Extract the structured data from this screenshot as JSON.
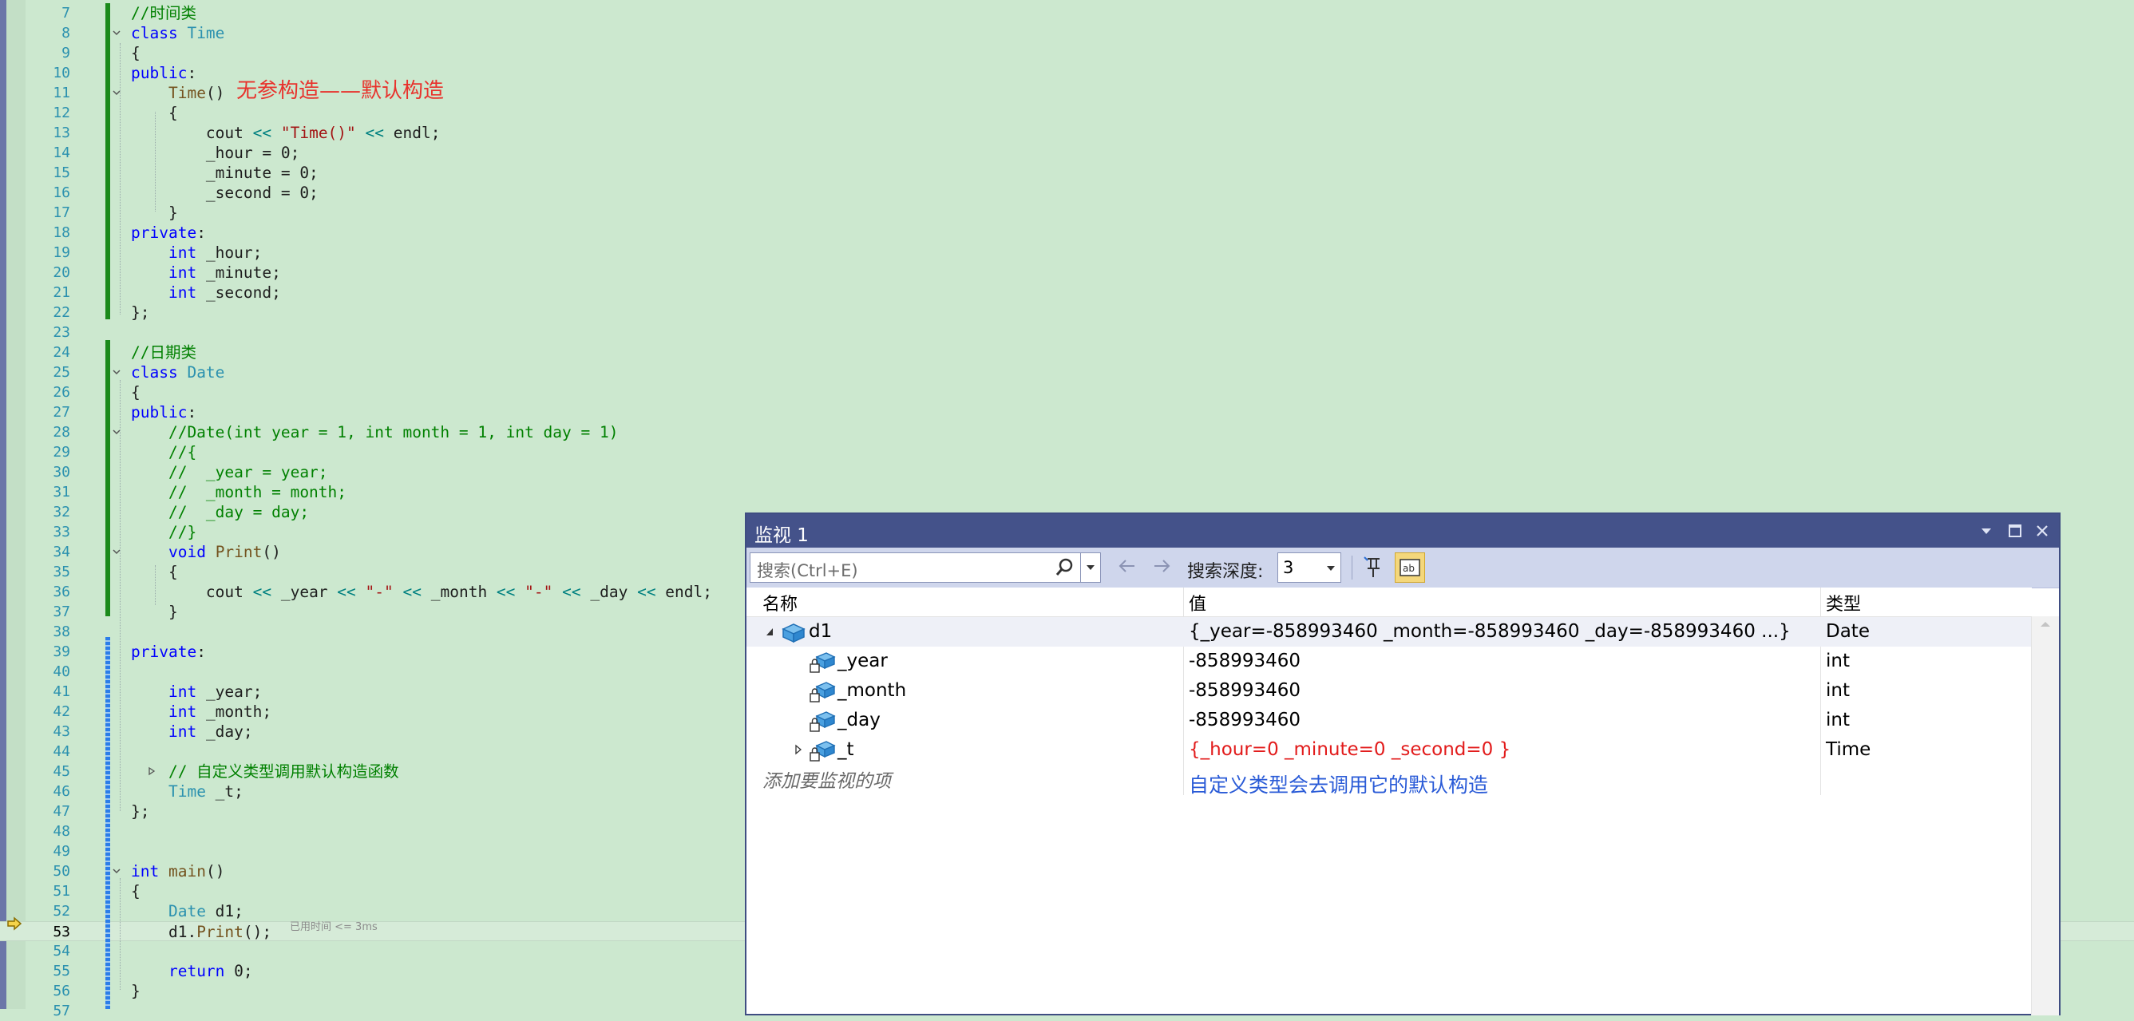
{
  "editor": {
    "lines": [
      {
        "n": "7",
        "segs": [
          {
            "c": "cm",
            "t": "//时间类"
          }
        ]
      },
      {
        "n": "8",
        "segs": [
          {
            "c": "kw",
            "t": "class "
          },
          {
            "c": "type",
            "t": "Time"
          }
        ]
      },
      {
        "n": "9",
        "segs": [
          {
            "c": "",
            "t": "{"
          }
        ]
      },
      {
        "n": "10",
        "segs": [
          {
            "c": "kw",
            "t": "public"
          },
          {
            "c": "",
            "t": ":"
          }
        ]
      },
      {
        "n": "11",
        "segs": [
          {
            "c": "",
            "t": "    "
          },
          {
            "c": "fn",
            "t": "Time"
          },
          {
            "c": "",
            "t": "()"
          }
        ]
      },
      {
        "n": "12",
        "segs": [
          {
            "c": "",
            "t": "    {"
          }
        ]
      },
      {
        "n": "13",
        "segs": [
          {
            "c": "",
            "t": "        cout "
          },
          {
            "c": "op",
            "t": "<<"
          },
          {
            "c": "",
            "t": " "
          },
          {
            "c": "str",
            "t": "\"Time()\""
          },
          {
            "c": "",
            "t": " "
          },
          {
            "c": "op",
            "t": "<<"
          },
          {
            "c": "",
            "t": " endl;"
          }
        ]
      },
      {
        "n": "14",
        "segs": [
          {
            "c": "",
            "t": "        _hour = 0;"
          }
        ]
      },
      {
        "n": "15",
        "segs": [
          {
            "c": "",
            "t": "        _minute = 0;"
          }
        ]
      },
      {
        "n": "16",
        "segs": [
          {
            "c": "",
            "t": "        _second = 0;"
          }
        ]
      },
      {
        "n": "17",
        "segs": [
          {
            "c": "",
            "t": "    }"
          }
        ]
      },
      {
        "n": "18",
        "segs": [
          {
            "c": "kw",
            "t": "private"
          },
          {
            "c": "",
            "t": ":"
          }
        ]
      },
      {
        "n": "19",
        "segs": [
          {
            "c": "",
            "t": "    "
          },
          {
            "c": "kw",
            "t": "int"
          },
          {
            "c": "",
            "t": " _hour;"
          }
        ]
      },
      {
        "n": "20",
        "segs": [
          {
            "c": "",
            "t": "    "
          },
          {
            "c": "kw",
            "t": "int"
          },
          {
            "c": "",
            "t": " _minute;"
          }
        ]
      },
      {
        "n": "21",
        "segs": [
          {
            "c": "",
            "t": "    "
          },
          {
            "c": "kw",
            "t": "int"
          },
          {
            "c": "",
            "t": " _second;"
          }
        ]
      },
      {
        "n": "22",
        "segs": [
          {
            "c": "",
            "t": "};"
          }
        ]
      },
      {
        "n": "23",
        "segs": []
      },
      {
        "n": "24",
        "segs": [
          {
            "c": "cm",
            "t": "//日期类"
          }
        ]
      },
      {
        "n": "25",
        "segs": [
          {
            "c": "kw",
            "t": "class "
          },
          {
            "c": "type",
            "t": "Date"
          }
        ]
      },
      {
        "n": "26",
        "segs": [
          {
            "c": "",
            "t": "{"
          }
        ]
      },
      {
        "n": "27",
        "segs": [
          {
            "c": "kw",
            "t": "public"
          },
          {
            "c": "",
            "t": ":"
          }
        ]
      },
      {
        "n": "28",
        "segs": [
          {
            "c": "cm",
            "t": "    //Date(int year = 1, int month = 1, int day = 1)"
          }
        ]
      },
      {
        "n": "29",
        "segs": [
          {
            "c": "cm",
            "t": "    //{"
          }
        ]
      },
      {
        "n": "30",
        "segs": [
          {
            "c": "cm",
            "t": "    //  _year = year;"
          }
        ]
      },
      {
        "n": "31",
        "segs": [
          {
            "c": "cm",
            "t": "    //  _month = month;"
          }
        ]
      },
      {
        "n": "32",
        "segs": [
          {
            "c": "cm",
            "t": "    //  _day = day;"
          }
        ]
      },
      {
        "n": "33",
        "segs": [
          {
            "c": "cm",
            "t": "    //}"
          }
        ]
      },
      {
        "n": "34",
        "segs": [
          {
            "c": "",
            "t": "    "
          },
          {
            "c": "kw",
            "t": "void"
          },
          {
            "c": "",
            "t": " "
          },
          {
            "c": "fn",
            "t": "Print"
          },
          {
            "c": "",
            "t": "()"
          }
        ]
      },
      {
        "n": "35",
        "segs": [
          {
            "c": "",
            "t": "    {"
          }
        ]
      },
      {
        "n": "36",
        "segs": [
          {
            "c": "",
            "t": "        cout "
          },
          {
            "c": "op",
            "t": "<<"
          },
          {
            "c": "",
            "t": " _year "
          },
          {
            "c": "op",
            "t": "<<"
          },
          {
            "c": "",
            "t": " "
          },
          {
            "c": "str",
            "t": "\"-\""
          },
          {
            "c": "",
            "t": " "
          },
          {
            "c": "op",
            "t": "<<"
          },
          {
            "c": "",
            "t": " _month "
          },
          {
            "c": "op",
            "t": "<<"
          },
          {
            "c": "",
            "t": " "
          },
          {
            "c": "str",
            "t": "\"-\""
          },
          {
            "c": "",
            "t": " "
          },
          {
            "c": "op",
            "t": "<<"
          },
          {
            "c": "",
            "t": " _day "
          },
          {
            "c": "op",
            "t": "<<"
          },
          {
            "c": "",
            "t": " endl;"
          }
        ]
      },
      {
        "n": "37",
        "segs": [
          {
            "c": "",
            "t": "    }"
          }
        ]
      },
      {
        "n": "38",
        "segs": []
      },
      {
        "n": "39",
        "segs": [
          {
            "c": "kw",
            "t": "private"
          },
          {
            "c": "",
            "t": ":"
          }
        ]
      },
      {
        "n": "40",
        "segs": []
      },
      {
        "n": "41",
        "segs": [
          {
            "c": "",
            "t": "    "
          },
          {
            "c": "kw",
            "t": "int"
          },
          {
            "c": "",
            "t": " _year;"
          }
        ]
      },
      {
        "n": "42",
        "segs": [
          {
            "c": "",
            "t": "    "
          },
          {
            "c": "kw",
            "t": "int"
          },
          {
            "c": "",
            "t": " _month;"
          }
        ]
      },
      {
        "n": "43",
        "segs": [
          {
            "c": "",
            "t": "    "
          },
          {
            "c": "kw",
            "t": "int"
          },
          {
            "c": "",
            "t": " _day;"
          }
        ]
      },
      {
        "n": "44",
        "segs": []
      },
      {
        "n": "45",
        "segs": [
          {
            "c": "cm",
            "t": "    // 自定义类型调用默认构造函数"
          }
        ]
      },
      {
        "n": "46",
        "segs": [
          {
            "c": "",
            "t": "    "
          },
          {
            "c": "type",
            "t": "Time"
          },
          {
            "c": "",
            "t": " _t;"
          }
        ]
      },
      {
        "n": "47",
        "segs": [
          {
            "c": "",
            "t": "};"
          }
        ]
      },
      {
        "n": "48",
        "segs": []
      },
      {
        "n": "49",
        "segs": []
      },
      {
        "n": "50",
        "segs": [
          {
            "c": "kw",
            "t": "int"
          },
          {
            "c": "",
            "t": " "
          },
          {
            "c": "fn",
            "t": "main"
          },
          {
            "c": "",
            "t": "()"
          }
        ]
      },
      {
        "n": "51",
        "segs": [
          {
            "c": "",
            "t": "{"
          }
        ]
      },
      {
        "n": "52",
        "segs": [
          {
            "c": "",
            "t": "    "
          },
          {
            "c": "type",
            "t": "Date"
          },
          {
            "c": "",
            "t": " d1;"
          }
        ]
      },
      {
        "n": "53",
        "segs": [
          {
            "c": "",
            "t": "    d1."
          },
          {
            "c": "fn",
            "t": "Print"
          },
          {
            "c": "",
            "t": "();"
          }
        ]
      },
      {
        "n": "54",
        "segs": []
      },
      {
        "n": "55",
        "segs": [
          {
            "c": "",
            "t": "    "
          },
          {
            "c": "kw",
            "t": "return"
          },
          {
            "c": "",
            "t": " 0;"
          }
        ]
      },
      {
        "n": "56",
        "segs": [
          {
            "c": "",
            "t": "}"
          }
        ]
      },
      {
        "n": "57",
        "segs": []
      }
    ],
    "current_line": "53",
    "annotation": "无参构造——默认构造",
    "elapsed_hint": "已用时间 <= 3ms"
  },
  "watch": {
    "title": "监视 1",
    "search_placeholder": "搜索(Ctrl+E)",
    "depth_label": "搜索深度:",
    "depth_value": "3",
    "columns": {
      "name": "名称",
      "value": "值",
      "type": "类型"
    },
    "rows": [
      {
        "name": "d1",
        "value": "{_year=-858993460 _month=-858993460 _day=-858993460 ...}",
        "type": "Date",
        "level": 0,
        "expander": "expanded",
        "icon": "object-icon",
        "red": false
      },
      {
        "name": "_year",
        "value": "-858993460",
        "type": "int",
        "level": 1,
        "expander": "none",
        "icon": "private-field-icon",
        "red": false
      },
      {
        "name": "_month",
        "value": "-858993460",
        "type": "int",
        "level": 1,
        "expander": "none",
        "icon": "private-field-icon",
        "red": false
      },
      {
        "name": "_day",
        "value": "-858993460",
        "type": "int",
        "level": 1,
        "expander": "none",
        "icon": "private-field-icon",
        "red": false
      },
      {
        "name": "_t",
        "value": "{_hour=0 _minute=0 _second=0 }",
        "type": "Time",
        "level": 1,
        "expander": "collapsed",
        "icon": "private-field-icon",
        "red": true
      }
    ],
    "add_item_text": "添加要监视的项",
    "note": "自定义类型会去调用它的默认构造"
  }
}
